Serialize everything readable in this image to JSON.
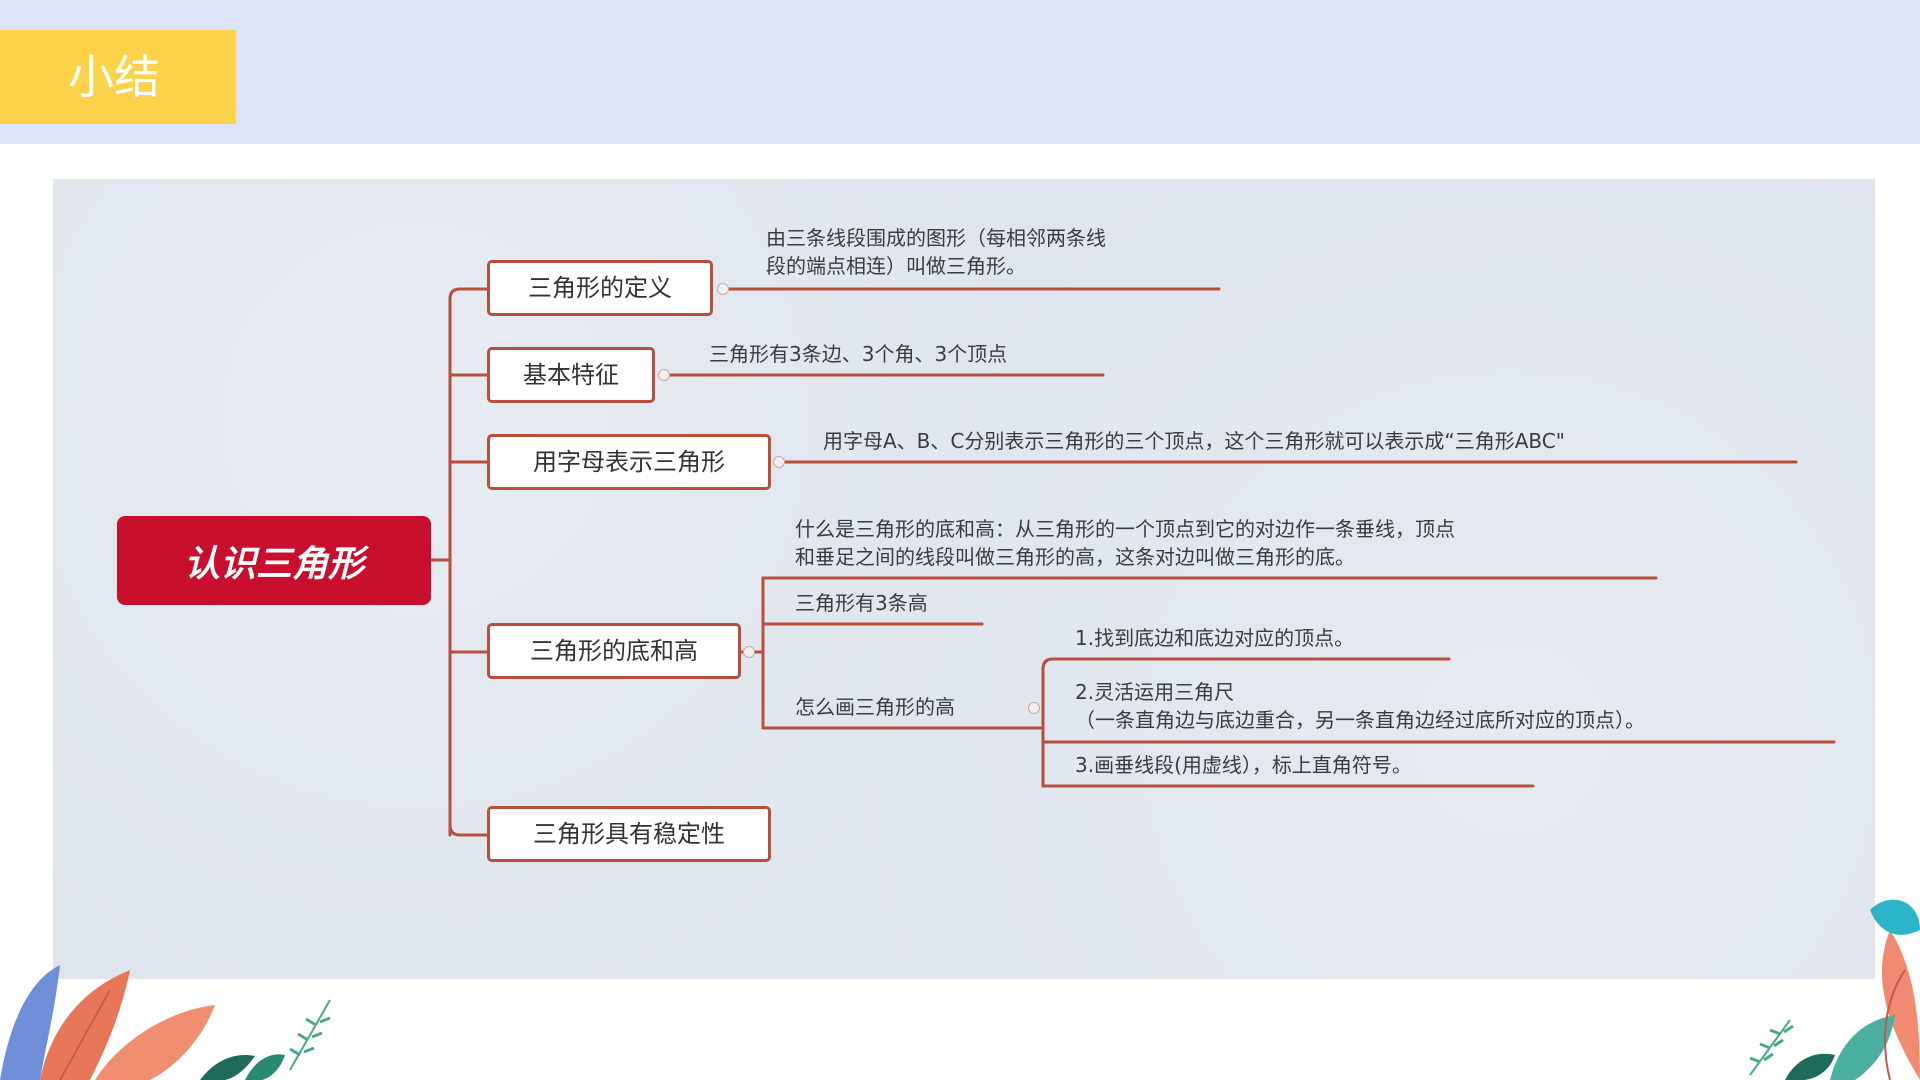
{
  "header": {
    "title": "小结"
  },
  "mindmap": {
    "root": "认识三角形",
    "definition": {
      "label": "三角形的定义",
      "text_line1": "由三条线段围成的图形（每相邻两条线",
      "text_line2": "段的端点相连）叫做三角形。"
    },
    "features": {
      "label": "基本特征",
      "text": "三角形有3条边、3个角、3个顶点"
    },
    "letters": {
      "label": "用字母表示三角形",
      "text": "用字母A、B、C分别表示三角形的三个顶点，这个三角形就可以表示成“三角形ABC\""
    },
    "base_height": {
      "label": "三角形的底和高",
      "what_line1": "什么是三角形的底和高：从三角形的一个顶点到它的对边作一条垂线，顶点",
      "what_line2": "和垂足之间的线段叫做三角形的高，这条对边叫做三角形的底。",
      "count": "三角形有3条高",
      "how_to": {
        "label": "怎么画三角形的高",
        "step1": "1.找到底边和底边对应的顶点。",
        "step2_line1": "2.灵活运用三角尺",
        "step2_line2": "（一条直角边与底边重合，另一条直角边经过底所对应的顶点）。",
        "step3": "3.画垂线段(用虚线），标上直角符号。"
      }
    },
    "stability": {
      "label": "三角形具有稳定性"
    }
  },
  "colors": {
    "header_band": "#dce3fb",
    "title_box": "#fcd24a",
    "root_fill": "#c8102e",
    "branch_line": "#b94e3c",
    "panel": "#dfe5ed"
  }
}
